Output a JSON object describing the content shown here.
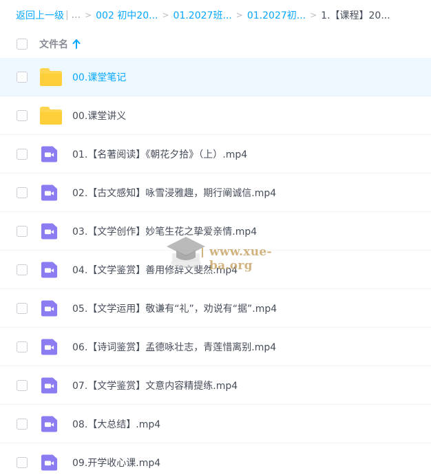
{
  "breadcrumb": {
    "back_label": "返回上一级",
    "divider": "|",
    "ellipsis": "...",
    "items": [
      "002 初中20...",
      "01.2027班...",
      "01.2027初..."
    ],
    "current": "1.【课程】20..."
  },
  "header": {
    "name_column": "文件名"
  },
  "files": [
    {
      "name": "00.课堂笔记",
      "type": "folder",
      "selected": true
    },
    {
      "name": "00.课堂讲义",
      "type": "folder",
      "selected": false
    },
    {
      "name": "01.【名著阅读】《朝花夕拾》（上）.mp4",
      "type": "video",
      "selected": false
    },
    {
      "name": "02.【古文感知】咏雪浸雅趣，期行阐诚信.mp4",
      "type": "video",
      "selected": false
    },
    {
      "name": "03.【文学创作】妙笔生花之挚爱亲情.mp4",
      "type": "video",
      "selected": false
    },
    {
      "name": "04.【文学鉴赏】善用修辞文斐然.mp4",
      "type": "video",
      "selected": false
    },
    {
      "name": "05.【文学运用】敬谦有“礼”，劝说有“据”.mp4",
      "type": "video",
      "selected": false
    },
    {
      "name": "06.【诗词鉴赏】孟德咏壮志，青莲惜离别.mp4",
      "type": "video",
      "selected": false
    },
    {
      "name": "07.【文学鉴赏】文意内容精提练.mp4",
      "type": "video",
      "selected": false
    },
    {
      "name": "08.【大总结】.mp4",
      "type": "video",
      "selected": false
    },
    {
      "name": "09.开学收心课.mp4",
      "type": "video",
      "selected": false
    }
  ],
  "watermark": {
    "text": "www.xue-ba.org"
  },
  "colors": {
    "accent": "#06a7ff",
    "folder": "#ffd54f",
    "video": "#8c7cf2",
    "text": "#454d5a",
    "selected_bg": "#eef8ff"
  }
}
